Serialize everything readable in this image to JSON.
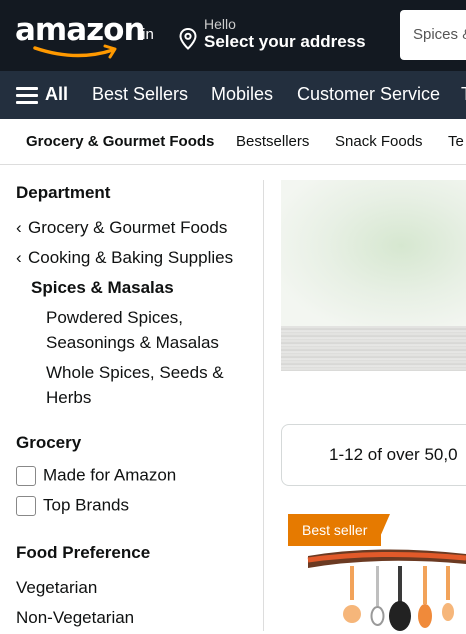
{
  "header": {
    "logo": "amazon",
    "logo_suffix": ".in",
    "address_greeting": "Hello",
    "address_prompt": "Select your address",
    "search_value": "Spices &"
  },
  "nav": {
    "all_label": "All",
    "items": [
      "Best Sellers",
      "Mobiles",
      "Customer Service",
      "T"
    ]
  },
  "subnav": {
    "items": [
      "Grocery & Gourmet Foods",
      "Bestsellers",
      "Snack Foods",
      "Te"
    ]
  },
  "sidebar": {
    "department_heading": "Department",
    "breadcrumbs": [
      "Grocery & Gourmet Foods",
      "Cooking & Baking Supplies"
    ],
    "current": "Spices & Masalas",
    "subcategories": [
      "Powdered Spices, Seasonings & Masalas",
      "Whole Spices, Seeds & Herbs"
    ],
    "grocery_heading": "Grocery",
    "grocery_options": [
      "Made for Amazon",
      "Top Brands"
    ],
    "food_pref_heading": "Food Preference",
    "food_pref_options": [
      "Vegetarian",
      "Non-Vegetarian"
    ]
  },
  "results": {
    "count_text": "1-12 of over 50,0"
  },
  "product": {
    "badge": "Best seller"
  },
  "colors": {
    "topbar": "#131921",
    "navbar": "#232f3e",
    "smile": "#ff9900",
    "badge": "#e67a00"
  }
}
